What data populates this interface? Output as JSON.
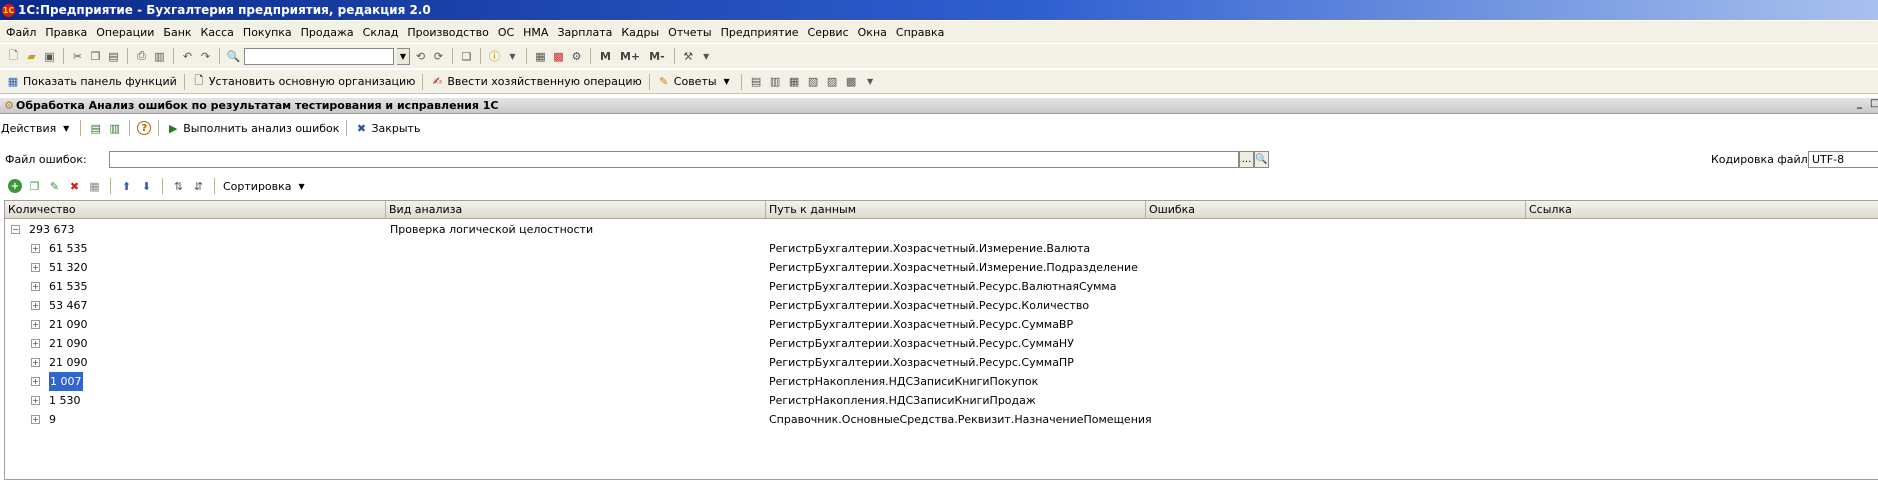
{
  "window": {
    "title": "1С:Предприятие - Бухгалтерия предприятия, редакция 2.0",
    "logo_text": "1С"
  },
  "menu": [
    "Файл",
    "Правка",
    "Операции",
    "Банк",
    "Касса",
    "Покупка",
    "Продажа",
    "Склад",
    "Производство",
    "ОС",
    "НМА",
    "Зарплата",
    "Кадры",
    "Отчеты",
    "Предприятие",
    "Сервис",
    "Окна",
    "Справка"
  ],
  "toolbar2": {
    "show_panel": "Показать панель функций",
    "set_org": "Установить основную организацию",
    "enter_op": "Ввести хозяйственную операцию",
    "tips": "Советы"
  },
  "toolbar1": {
    "m": "M",
    "m_plus": "M+",
    "m_minus": "M-"
  },
  "form": {
    "title": "Обработка  Анализ ошибок по результатам тестирования и исправления 1С",
    "actions": "Действия",
    "run": "Выполнить анализ ошибок",
    "close": "Закрыть",
    "help": "?",
    "file_label": "Файл ошибок:",
    "file_value": "",
    "browse": "...",
    "encoding_label": "Кодировка файла:",
    "encoding_value": "UTF-8",
    "sort": "Сортировка"
  },
  "table": {
    "columns": [
      "Количество",
      "Вид анализа",
      "Путь к данным",
      "Ошибка",
      "Ссылка"
    ],
    "rows": [
      {
        "level": 0,
        "qty": "293 673",
        "kind": "Проверка логической целостности",
        "path": "",
        "expanded": true
      },
      {
        "level": 1,
        "qty": "61 535",
        "kind": "",
        "path": "РегистрБухгалтерии.Хозрасчетный.Измерение.Валюта"
      },
      {
        "level": 1,
        "qty": "51 320",
        "kind": "",
        "path": "РегистрБухгалтерии.Хозрасчетный.Измерение.Подразделение"
      },
      {
        "level": 1,
        "qty": "61 535",
        "kind": "",
        "path": "РегистрБухгалтерии.Хозрасчетный.Ресурс.ВалютнаяСумма"
      },
      {
        "level": 1,
        "qty": "53 467",
        "kind": "",
        "path": "РегистрБухгалтерии.Хозрасчетный.Ресурс.Количество"
      },
      {
        "level": 1,
        "qty": "21 090",
        "kind": "",
        "path": "РегистрБухгалтерии.Хозрасчетный.Ресурс.СуммаВР"
      },
      {
        "level": 1,
        "qty": "21 090",
        "kind": "",
        "path": "РегистрБухгалтерии.Хозрасчетный.Ресурс.СуммаНУ"
      },
      {
        "level": 1,
        "qty": "21 090",
        "kind": "",
        "path": "РегистрБухгалтерии.Хозрасчетный.Ресурс.СуммаПР"
      },
      {
        "level": 1,
        "qty": "1 007",
        "kind": "",
        "path": "РегистрНакопления.НДСЗаписиКнигиПокупок",
        "selected": true
      },
      {
        "level": 1,
        "qty": "1 530",
        "kind": "",
        "path": "РегистрНакопления.НДСЗаписиКнигиПродаж"
      },
      {
        "level": 1,
        "qty": "9",
        "kind": "",
        "path": "Справочник.ОсновныеСредства.Реквизит.НазначениеПомещения"
      }
    ]
  }
}
